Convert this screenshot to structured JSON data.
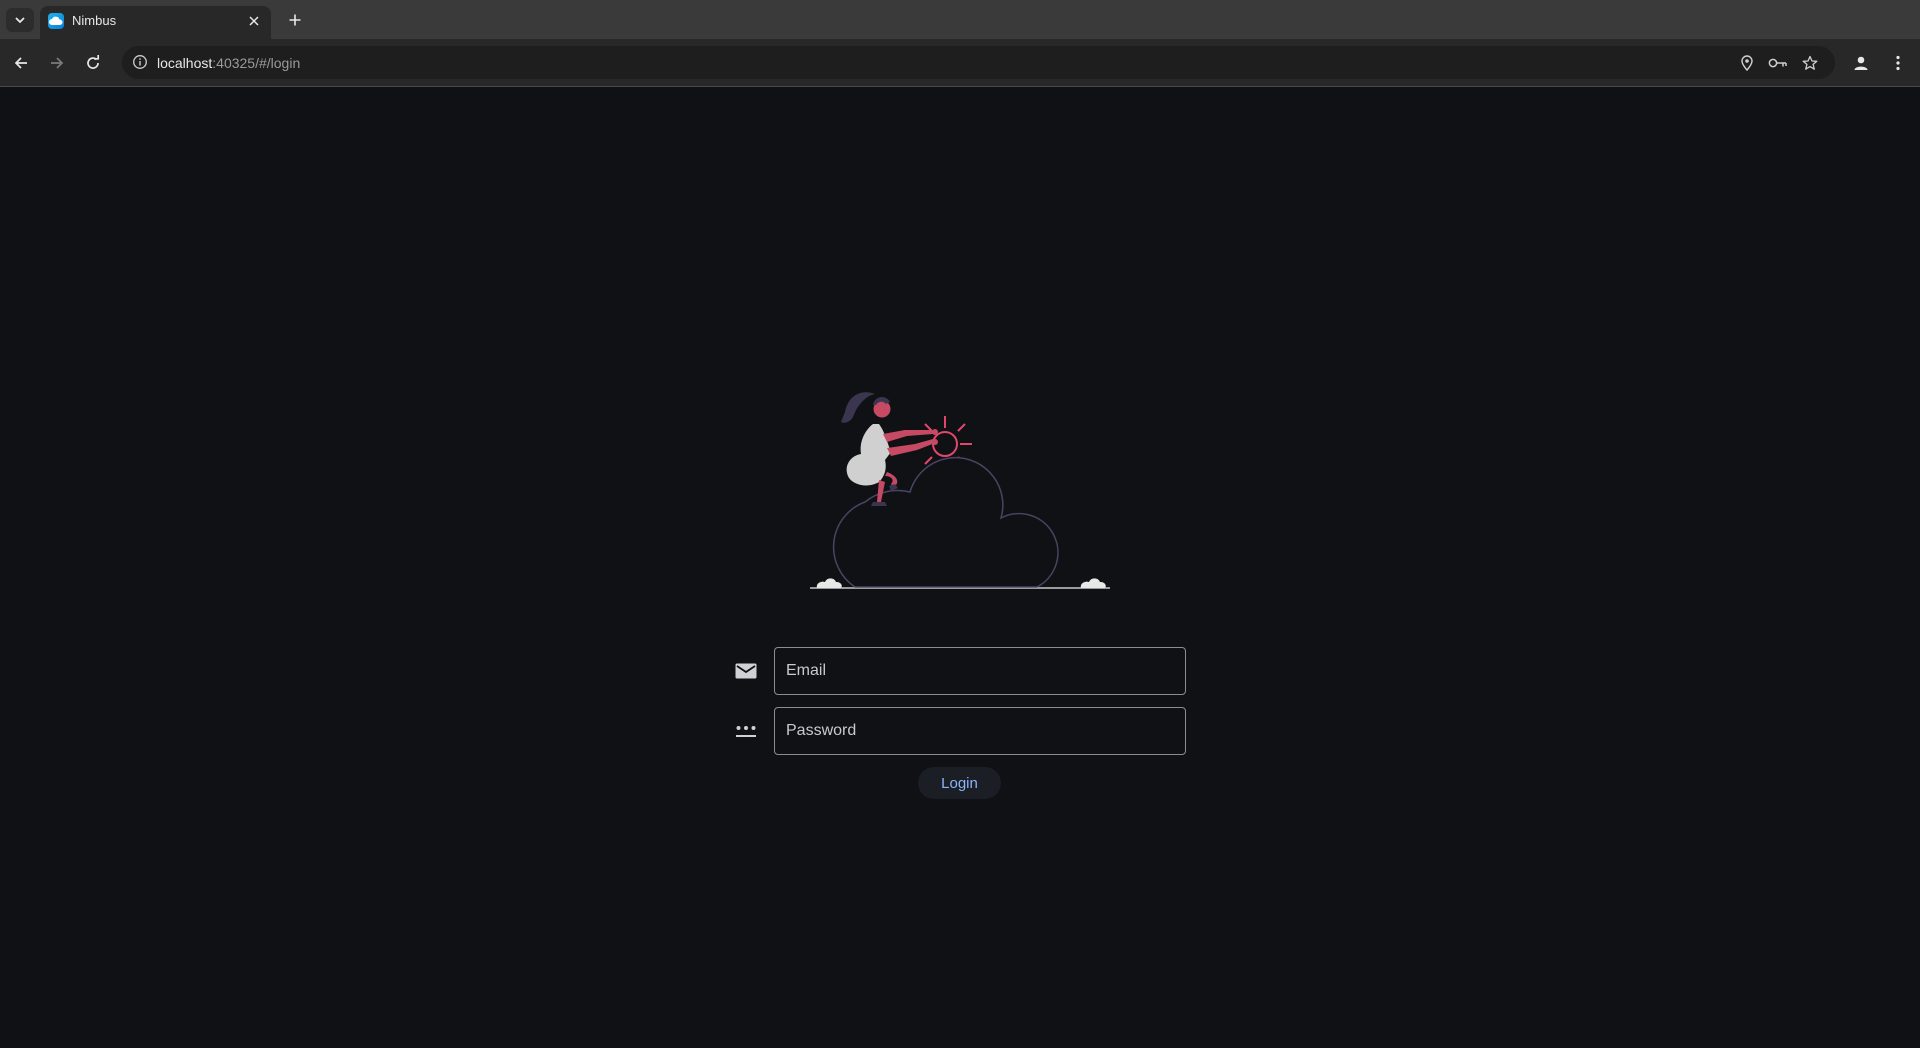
{
  "browser": {
    "tab_title": "Nimbus",
    "url_host": "localhost",
    "url_rest": ":40325/#/login"
  },
  "login": {
    "email_placeholder": "Email",
    "password_placeholder": "Password",
    "submit_label": "Login"
  },
  "colors": {
    "background": "#0f1115",
    "accent": "#e2476b",
    "link": "#8ab4f8"
  },
  "icons": {
    "email": "mail-icon",
    "password": "password-dots-icon"
  }
}
